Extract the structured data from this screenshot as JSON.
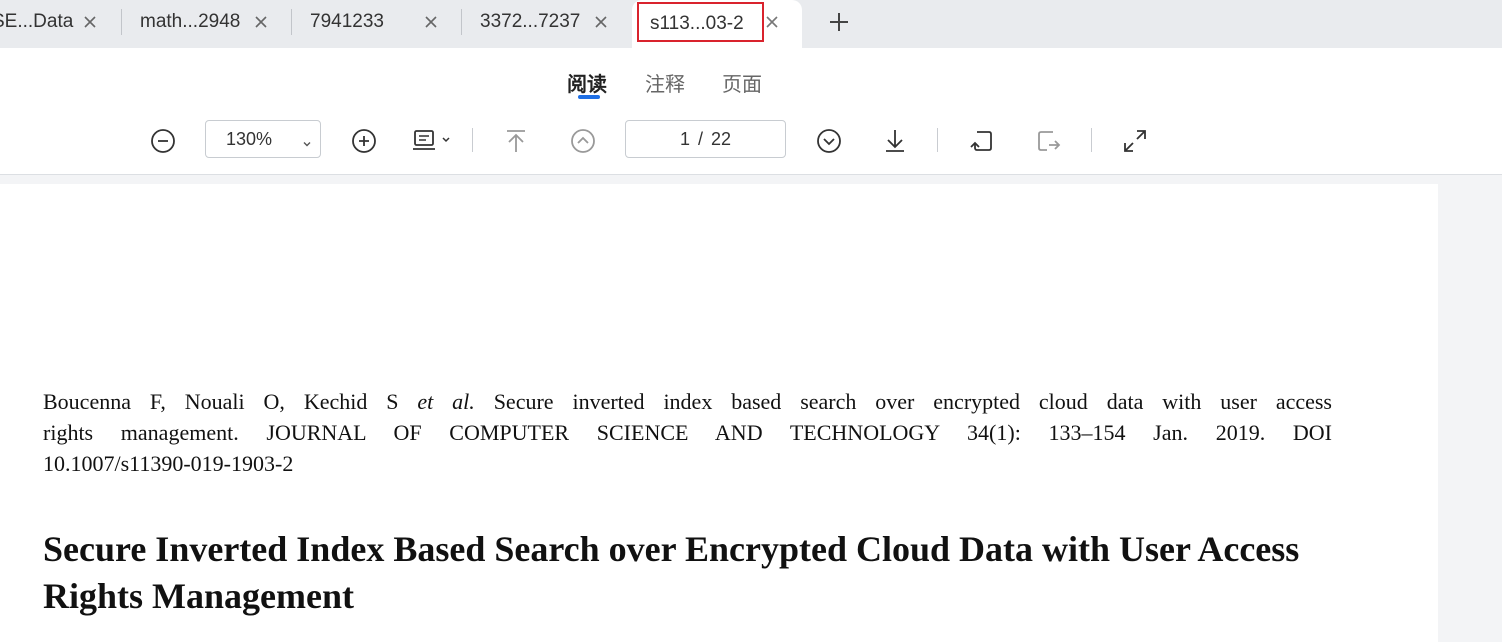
{
  "tabs": [
    {
      "label": "SE...Data"
    },
    {
      "label": "math...2948"
    },
    {
      "label": "7941233"
    },
    {
      "label": "3372...7237"
    },
    {
      "label": "s113...03-2",
      "active": true
    }
  ],
  "view_modes": {
    "read": "阅读",
    "annotate": "注释",
    "pages": "页面",
    "active": "read"
  },
  "toolbar": {
    "zoom_value": "130%",
    "current_page": "1",
    "page_separator": "/",
    "total_pages": "22",
    "icons": [
      "zoom-out-icon",
      "zoom-in-icon",
      "fit-page-icon",
      "first-page-icon",
      "previous-page-icon",
      "next-page-icon",
      "last-page-icon",
      "rotate-left-icon",
      "rotate-right-icon",
      "fullscreen-icon"
    ]
  },
  "document": {
    "citation_line1_prefix": "Boucenna F, Nouali O, Kechid S ",
    "citation_line1_etal": "et al.",
    "citation_line1_rest": " Secure inverted index based search over encrypted cloud data with user access",
    "citation_line2": "rights management.  JOURNAL OF COMPUTER SCIENCE AND TECHNOLOGY  34(1): 133–154  Jan. 2019. DOI",
    "citation_line3": "10.1007/s11390-019-1903-2",
    "title": "Secure Inverted Index Based Search over Encrypted Cloud Data with User Access Rights Management"
  },
  "colors": {
    "tabstrip_bg": "#e9ebee",
    "active_highlight": "#d9232d",
    "accent": "#1f6fe5",
    "doc_bg": "#f3f4f6"
  }
}
